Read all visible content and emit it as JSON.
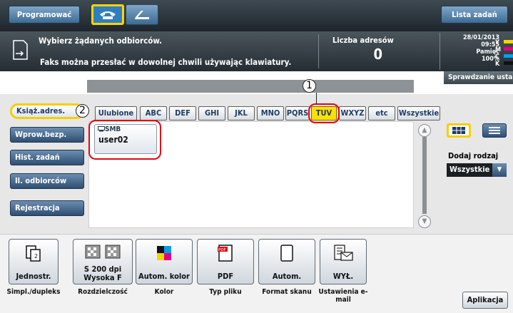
{
  "header": {
    "program_label": "Programować",
    "job_list_label": "Lista zadań"
  },
  "message": {
    "line1": "Wybierz żądanych odbiorców.",
    "line2": "Faks można przesłać w dowolnej chwili używając klawiatury.",
    "address_count_label": "Liczba adresów",
    "address_count": "0"
  },
  "status": {
    "date": "28/01/2013",
    "time": "09:55",
    "memory_label": "Pamięć",
    "memory_value": "100%",
    "toner_colors": [
      "#f2d500",
      "#e4007f",
      "#00a0e9",
      "#111111"
    ],
    "toner_letters": [
      "Y",
      "M",
      "C",
      "K"
    ],
    "check_label": "Sprawdzanie usta"
  },
  "sidebar": {
    "items": [
      {
        "label": "Książ.adres."
      },
      {
        "label": "Wprow.bezp."
      },
      {
        "label": "Hist. zadań"
      },
      {
        "label": "Il. odbiorców"
      },
      {
        "label": "Rejestracja"
      }
    ]
  },
  "tabs": [
    "Ulubione",
    "ABC",
    "DEF",
    "GHI",
    "JKL",
    "MNO",
    "PQRS",
    "TUV",
    "WXYZ",
    "etc",
    "Wszystkie"
  ],
  "selected_tab": "TUV",
  "entries": [
    {
      "type": "SMB",
      "name": "user02"
    }
  ],
  "callouts": [
    "1",
    "2"
  ],
  "filter": {
    "label": "Dodaj rodzaj",
    "value": "Wszystkie"
  },
  "settings": [
    {
      "value": "Jednostr.",
      "caption": "Simpl./dupleks",
      "icon": "page-icon"
    },
    {
      "value": "S 200 dpi Wysoka F",
      "caption": "Rozdzielczość",
      "icon": "resolution-icon"
    },
    {
      "value": "Autom. kolor",
      "caption": "Kolor",
      "icon": "color-icon"
    },
    {
      "value": "PDF",
      "caption": "Typ pliku",
      "icon": "pdf-icon"
    },
    {
      "value": "Autom.",
      "caption": "Format skanu",
      "icon": "paper-size-icon"
    },
    {
      "value": "WYŁ.",
      "caption": "Ustawienia e-mail",
      "icon": "email-icon"
    }
  ],
  "app_button": "Aplikacja"
}
